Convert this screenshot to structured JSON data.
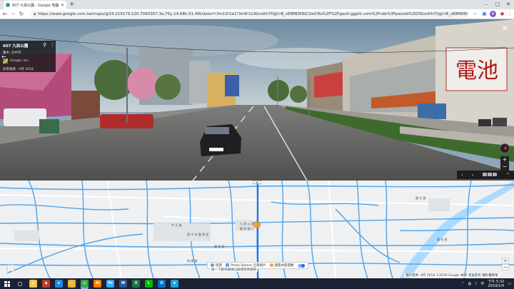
{
  "browser": {
    "tab_title": "607 九如公園 - Google 地圖",
    "new_tab": "+",
    "url": "https://www.google.com.tw/maps/@24.219179,120.7060307,3a,75y,14.68h,91.49t/data=!3m10!1e1!3m8!1s3GncKh7OgCrB_vE8MDE8Q!2e0!6s%2F%2Fgeo0.ggpht.com%2Fcbk%3Fpanoid%3D3GncKh7OgCrB_vE8MDE8Q%26output%3Dthumbn..."
  },
  "street_view": {
    "place_name": "607 九如公園",
    "address": "臺中, 台中市",
    "source": "Google, Inc.",
    "capture_date": "街景服務 - 4月 2018",
    "plate": "D-5"
  },
  "map": {
    "labels": [
      {
        "text": "豐 東 路",
        "key": "road1"
      },
      {
        "text": "臺 中 市 豐 原 區",
        "key": "area"
      },
      {
        "text": "豐 社 路",
        "key": "road2"
      },
      {
        "text": "九 如 公 園",
        "key": "park"
      },
      {
        "text": "豐 原 國 小",
        "key": "school"
      },
      {
        "text": "中 正 路",
        "key": "road3"
      },
      {
        "text": "南 陽 路",
        "key": "road4"
      }
    ],
    "legend": {
      "street_view": "街景",
      "photo_sphere": "Photo Sphere 全景相片",
      "indoor": "建築內部景觀"
    },
    "legend_note": "按一下藍色路線以檢視街景服務",
    "footer": "相片提供: 4月 2018  ©2019 Google  條款  發送意見  隱私權政策"
  },
  "taskbar": {
    "time": "下午 5:32",
    "date": "2019/1/4",
    "apps": [
      {
        "name": "file-explorer",
        "label": "▤",
        "color": "#f2c14b"
      },
      {
        "name": "store",
        "label": "◆",
        "color": "#c0392b"
      },
      {
        "name": "edge",
        "label": "e",
        "color": "#1e88e5"
      },
      {
        "name": "folder",
        "label": "▭",
        "color": "#e6b43b"
      },
      {
        "name": "chrome",
        "label": "◎",
        "color": "#34a853"
      },
      {
        "name": "illustrator",
        "label": "Ai",
        "color": "#ff7c00"
      },
      {
        "name": "photoshop",
        "label": "Ps",
        "color": "#31a8ff"
      },
      {
        "name": "word",
        "label": "W",
        "color": "#2b579a"
      },
      {
        "name": "excel",
        "label": "X",
        "color": "#217346"
      },
      {
        "name": "line",
        "label": "L",
        "color": "#00b900"
      },
      {
        "name": "outlook",
        "label": "O",
        "color": "#0072c6"
      },
      {
        "name": "ie",
        "label": "e",
        "color": "#1ba1e2"
      }
    ]
  },
  "colors": {
    "road_blue": "#4fa3e8",
    "river": "#aadaff",
    "accent": "#1a73e8"
  }
}
